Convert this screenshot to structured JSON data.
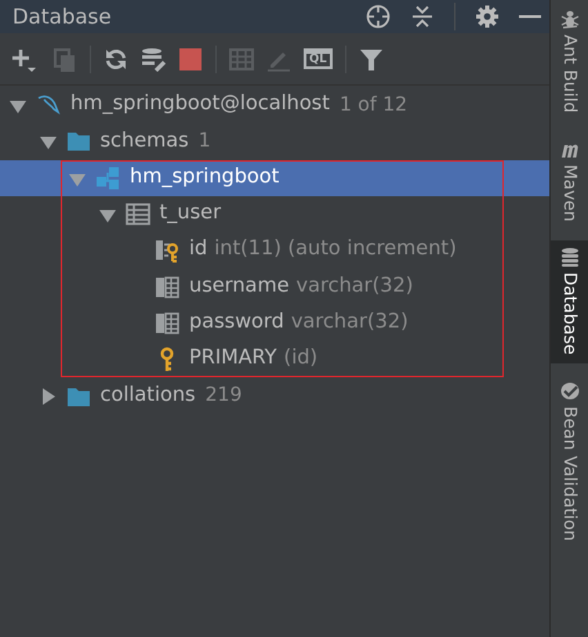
{
  "panel": {
    "title": "Database"
  },
  "header_actions": [
    {
      "kind": "target"
    },
    {
      "kind": "collapse"
    },
    {
      "kind": "separator"
    },
    {
      "kind": "settings"
    },
    {
      "kind": "minimize"
    }
  ],
  "toolbar": [
    {
      "kind": "add",
      "disabled": false
    },
    {
      "kind": "copy",
      "disabled": true
    },
    {
      "kind": "separator"
    },
    {
      "kind": "refresh",
      "disabled": false
    },
    {
      "kind": "schema-tool",
      "disabled": false
    },
    {
      "kind": "stop",
      "disabled": false
    },
    {
      "kind": "separator"
    },
    {
      "kind": "table",
      "disabled": true
    },
    {
      "kind": "edit",
      "disabled": true
    },
    {
      "kind": "console",
      "label": "QL",
      "disabled": false
    },
    {
      "kind": "separator"
    },
    {
      "kind": "filter",
      "disabled": false
    }
  ],
  "tree": [
    {
      "kind": "connection",
      "name": "hm_springboot@localhost",
      "count": "1 of 12",
      "expanded": true,
      "selected": false,
      "children": [
        {
          "kind": "folder",
          "name": "schemas",
          "count": "1",
          "expanded": true,
          "selected": false,
          "children": [
            {
              "kind": "schema",
              "name": "hm_springboot",
              "expanded": true,
              "selected": true,
              "highlighted": true,
              "children": [
                {
                  "kind": "table",
                  "name": "t_user",
                  "expanded": true,
                  "selected": false,
                  "children": [
                    {
                      "kind": "key-column",
                      "name": "id",
                      "detail": "int(11) (auto increment)",
                      "selected": false
                    },
                    {
                      "kind": "column",
                      "name": "username",
                      "detail": "varchar(32)",
                      "selected": false
                    },
                    {
                      "kind": "column",
                      "name": "password",
                      "detail": "varchar(32)",
                      "selected": false
                    },
                    {
                      "kind": "index",
                      "name": "PRIMARY",
                      "detail": "(id)",
                      "selected": false
                    }
                  ]
                }
              ]
            }
          ]
        },
        {
          "kind": "folder",
          "name": "collations",
          "count": "219",
          "expanded": false,
          "selected": false
        }
      ]
    }
  ],
  "side_tabs": [
    {
      "kind": "ant",
      "label": "Ant Build",
      "selected": false
    },
    {
      "kind": "maven",
      "label": "Maven",
      "selected": false
    },
    {
      "kind": "database",
      "label": "Database",
      "selected": true
    },
    {
      "kind": "bean",
      "label": "Bean Validation",
      "selected": false
    }
  ]
}
